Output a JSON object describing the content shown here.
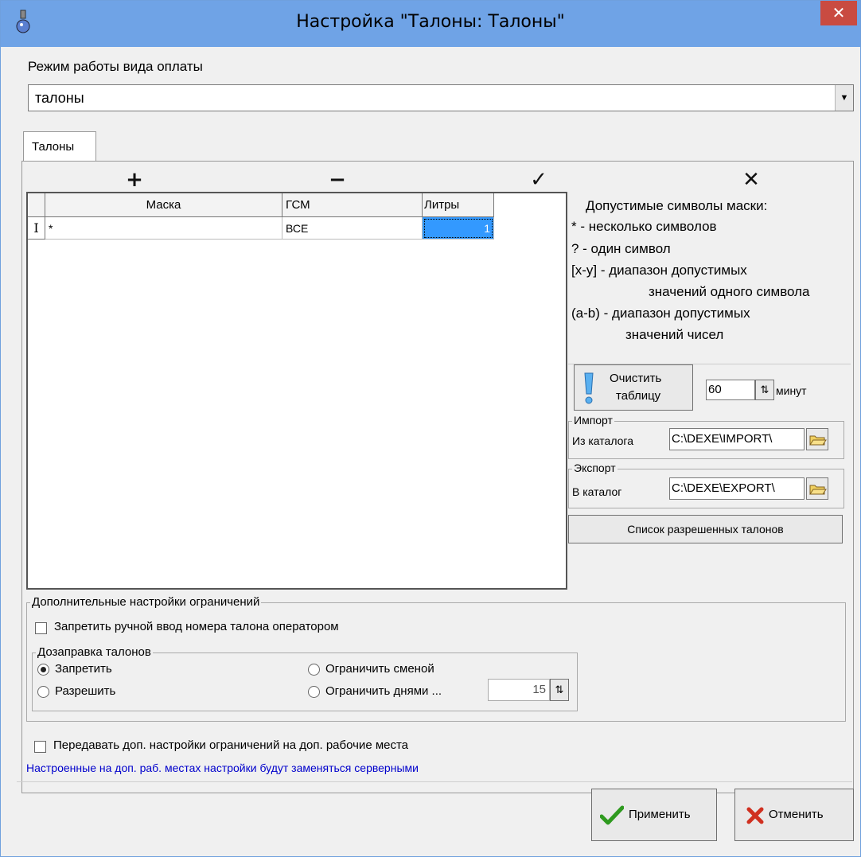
{
  "window": {
    "title": "Настройка \"Талоны: Талоны\"",
    "close_glyph": "✕"
  },
  "payment_mode": {
    "label": "Режим работы вида оплаты",
    "value": "талоны"
  },
  "tabs": [
    {
      "label": "Талоны"
    }
  ],
  "navigator": {
    "add": "+",
    "delete": "−",
    "post": "✓",
    "cancel": "✕"
  },
  "table": {
    "columns": [
      "Маска",
      "ГСМ",
      "Литры"
    ],
    "rows": [
      {
        "indicator": "I",
        "mask": "*",
        "fuel": "ВСЕ",
        "liters": "1"
      }
    ]
  },
  "mask_help": {
    "title": "Допустимые символы маски:",
    "lines": [
      "* - несколько символов",
      "? - один символ",
      "[x-y] - диапазон допустимых",
      "значений одного символа",
      "(a-b) - диапазон допустимых",
      "значений чисел"
    ]
  },
  "clear_table": {
    "label_line1": "Очистить",
    "label_line2": "таблицу",
    "minutes_value": "60",
    "minutes_unit": "минут"
  },
  "import": {
    "group_title": "Импорт",
    "label": "Из каталога",
    "path": "C:\\DEXE\\IMPORT\\"
  },
  "export": {
    "group_title": "Экспорт",
    "label": "В каталог",
    "path": "C:\\DEXE\\EXPORT\\"
  },
  "allowed_list_button": "Список разрешенных талонов",
  "restrictions": {
    "group_title": "Дополнительные настройки ограничений",
    "forbid_manual": {
      "label": "Запретить ручной ввод номера талона оператором",
      "checked": false
    },
    "refill": {
      "group_title": "Дозаправка талонов",
      "options": [
        {
          "label": "Запретить",
          "selected": true
        },
        {
          "label": "Разрешить",
          "selected": false
        },
        {
          "label": "Ограничить сменой",
          "selected": false
        },
        {
          "label": "Ограничить днями ...",
          "selected": false
        }
      ],
      "days_value": "15"
    }
  },
  "transfer_settings": {
    "label": "Передавать доп. настройки ограничений на доп. рабочие места",
    "checked": false
  },
  "info_text": "Настроенные на доп. раб. местах настройки будут заменяться серверными",
  "buttons": {
    "apply": "Применить",
    "cancel": "Отменить"
  },
  "colors": {
    "titlebar": "#6fa3e6",
    "close": "#c94b41",
    "info_text": "#0000cc",
    "selection": "#3399ff"
  }
}
